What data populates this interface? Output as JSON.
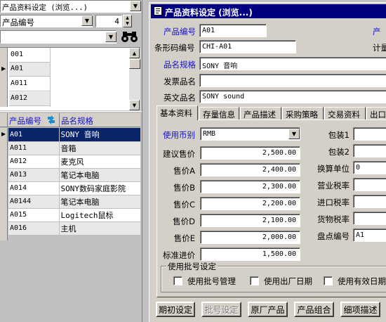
{
  "left": {
    "title_field": "产品资料设定 (浏览...)",
    "field_selector": "产品编号",
    "count_value": "4",
    "id_list": [
      "001",
      "A01",
      "A011",
      "A012"
    ],
    "grid_headers": [
      "产品编号",
      "品名规格"
    ],
    "rows": [
      {
        "code": "A01",
        "name": "SONY 音响"
      },
      {
        "code": "A011",
        "name": "音箱"
      },
      {
        "code": "A012",
        "name": "麦克风"
      },
      {
        "code": "A013",
        "name": "笔记本电脑"
      },
      {
        "code": "A014",
        "name": "SONY数码家庭影院"
      },
      {
        "code": "A0144",
        "name": "笔记本电脑"
      },
      {
        "code": "A015",
        "name": "Logitech鼠标"
      },
      {
        "code": "A016",
        "name": "主机"
      }
    ]
  },
  "window": {
    "title": "产品资料设定 (浏览...)",
    "labels": {
      "product_code": "产品编号",
      "barcode": "条形码编号",
      "spec": "品名规格",
      "invoice_name": "发票品名",
      "english_name": "英文品名",
      "right_product": "产",
      "right_unit": "计量"
    },
    "values": {
      "product_code": "A01",
      "barcode": "CHI-A01",
      "spec": "SONY 音响",
      "invoice_name": "",
      "english_name": "SONY sound"
    },
    "tabs": [
      "基本资料",
      "存量信息",
      "产品描述",
      "采购策略",
      "交易资料",
      "出口"
    ],
    "basic": {
      "currency_label": "使用币别",
      "currency_value": "RMB",
      "prices": [
        {
          "label": "建议售价",
          "value": "2,500.00"
        },
        {
          "label": "售价A",
          "value": "2,400.00"
        },
        {
          "label": "售价B",
          "value": "2,300.00"
        },
        {
          "label": "售价C",
          "value": "2,200.00"
        },
        {
          "label": "售价D",
          "value": "2,100.00"
        },
        {
          "label": "售价E",
          "value": "2,000.00"
        },
        {
          "label": "标准进价",
          "value": "1,500.00"
        }
      ],
      "right_labels": [
        "包装1",
        "包装2",
        "换算单位",
        "营业税率",
        "进口税率",
        "货物税率",
        "盘点编号"
      ],
      "right_values": [
        "",
        "",
        "0",
        "",
        "",
        "",
        "A1"
      ],
      "batch_group": "使用批号设定",
      "checks": [
        "使用批号管理",
        "使用出厂日期",
        "使用有效日期"
      ]
    },
    "buttons": [
      "期初设定",
      "批号设定",
      "原厂产品",
      "产品组合",
      "细项描述"
    ]
  }
}
